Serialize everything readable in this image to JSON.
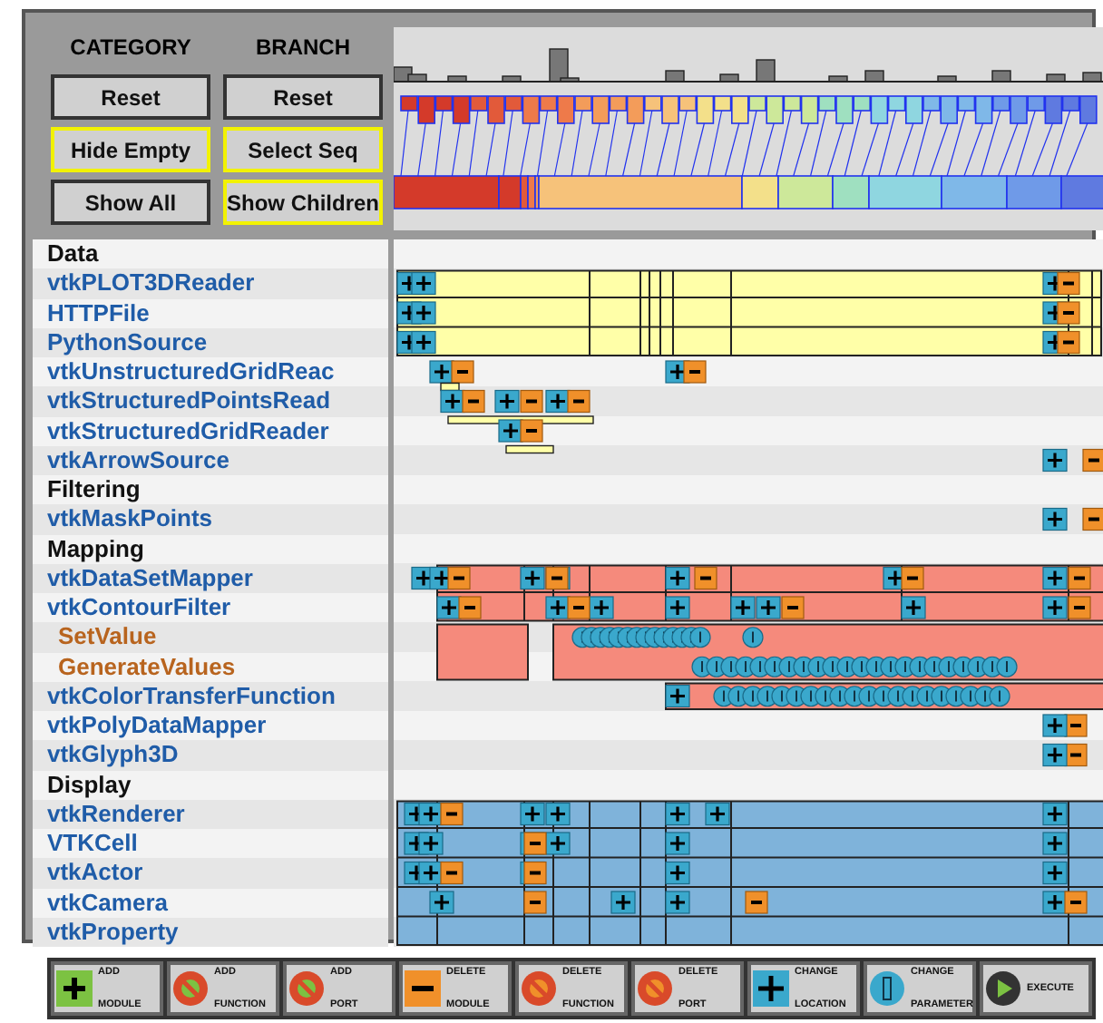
{
  "category_panel": {
    "title": "CATEGORY",
    "buttons": [
      {
        "label": "Reset",
        "highlighted": false
      },
      {
        "label": "Hide Empty",
        "highlighted": true
      },
      {
        "label": "Show All",
        "highlighted": false
      }
    ]
  },
  "branch_panel": {
    "title": "BRANCH",
    "buttons": [
      {
        "label": "Reset",
        "highlighted": false
      },
      {
        "label": "Select Seq",
        "highlighted": true
      },
      {
        "label": "Show Children",
        "highlighted": true
      }
    ]
  },
  "rows": [
    {
      "kind": "category",
      "label": "Data"
    },
    {
      "kind": "module",
      "label": "vtkPLOT3DReader"
    },
    {
      "kind": "module",
      "label": "HTTPFile"
    },
    {
      "kind": "module",
      "label": "PythonSource"
    },
    {
      "kind": "module",
      "label": "vtkUnstructuredGridReac"
    },
    {
      "kind": "module",
      "label": "vtkStructuredPointsRead"
    },
    {
      "kind": "module",
      "label": "vtkStructuredGridReader"
    },
    {
      "kind": "module",
      "label": "vtkArrowSource"
    },
    {
      "kind": "category",
      "label": "Filtering"
    },
    {
      "kind": "module",
      "label": "vtkMaskPoints"
    },
    {
      "kind": "category",
      "label": "Mapping"
    },
    {
      "kind": "module",
      "label": "vtkDataSetMapper"
    },
    {
      "kind": "module",
      "label": "vtkContourFilter"
    },
    {
      "kind": "function",
      "label": "SetValue"
    },
    {
      "kind": "function",
      "label": "GenerateValues"
    },
    {
      "kind": "module",
      "label": "vtkColorTransferFunction"
    },
    {
      "kind": "module",
      "label": "vtkPolyDataMapper"
    },
    {
      "kind": "module",
      "label": "vtkGlyph3D"
    },
    {
      "kind": "category",
      "label": "Display"
    },
    {
      "kind": "module",
      "label": "vtkRenderer"
    },
    {
      "kind": "module",
      "label": "VTKCell"
    },
    {
      "kind": "module",
      "label": "vtkActor"
    },
    {
      "kind": "module",
      "label": "vtkCamera"
    },
    {
      "kind": "module",
      "label": "vtkProperty"
    }
  ],
  "legend": [
    {
      "kind": "add-module",
      "top": "ADD",
      "bottom": "MODULE"
    },
    {
      "kind": "add-function",
      "top": "ADD",
      "bottom": "FUNCTION"
    },
    {
      "kind": "add-port",
      "top": "ADD",
      "bottom": "PORT"
    },
    {
      "kind": "delete-module",
      "top": "DELETE",
      "bottom": "MODULE"
    },
    {
      "kind": "delete-function",
      "top": "DELETE",
      "bottom": "FUNCTION"
    },
    {
      "kind": "delete-port",
      "top": "DELETE",
      "bottom": "PORT"
    },
    {
      "kind": "change-location",
      "top": "CHANGE",
      "bottom": "LOCATION"
    },
    {
      "kind": "change-parameter",
      "top": "CHANGE",
      "bottom": "PARAMETER"
    },
    {
      "kind": "execute",
      "top": "EXECUTE"
    }
  ]
}
